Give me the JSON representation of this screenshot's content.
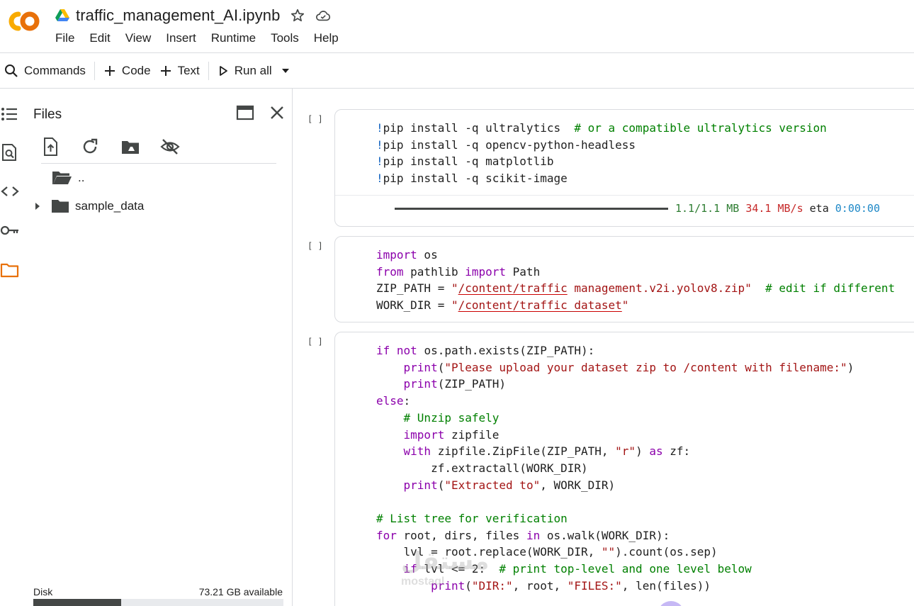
{
  "app": {
    "title": "traffic_management_AI.ipynb",
    "menu": [
      "File",
      "Edit",
      "View",
      "Insert",
      "Runtime",
      "Tools",
      "Help"
    ]
  },
  "toolbar": {
    "commands_label": "Commands",
    "code_label": "Code",
    "text_label": "Text",
    "run_all_label": "Run all"
  },
  "rail": {
    "icons": [
      "table-of-contents-icon",
      "find-replace-icon",
      "code-snippets-icon",
      "secrets-key-icon",
      "files-folder-icon"
    ]
  },
  "files": {
    "title": "Files",
    "parent_label": "..",
    "folder_label": "sample_data",
    "disk_label": "Disk",
    "disk_available": "73.21 GB available",
    "disk_used_fraction": 0.35
  },
  "cells": [
    {
      "exec_count": "[ ]",
      "output": {
        "progress_fraction": 1.0,
        "size": "1.1/1.1 MB",
        "speed": "34.1 MB/s",
        "eta_label": "eta",
        "eta": "0:00:00"
      }
    },
    {
      "exec_count": "[ ]"
    },
    {
      "exec_count": "[ ]"
    }
  ],
  "watermark": {
    "text": "مستقل",
    "sub": "mostaql"
  },
  "colors": {
    "accent_orange": "#e8710a",
    "logo_yellow": "#f9ab00",
    "keyword": "#8b00ab",
    "string": "#a31515",
    "comment": "#008000"
  }
}
